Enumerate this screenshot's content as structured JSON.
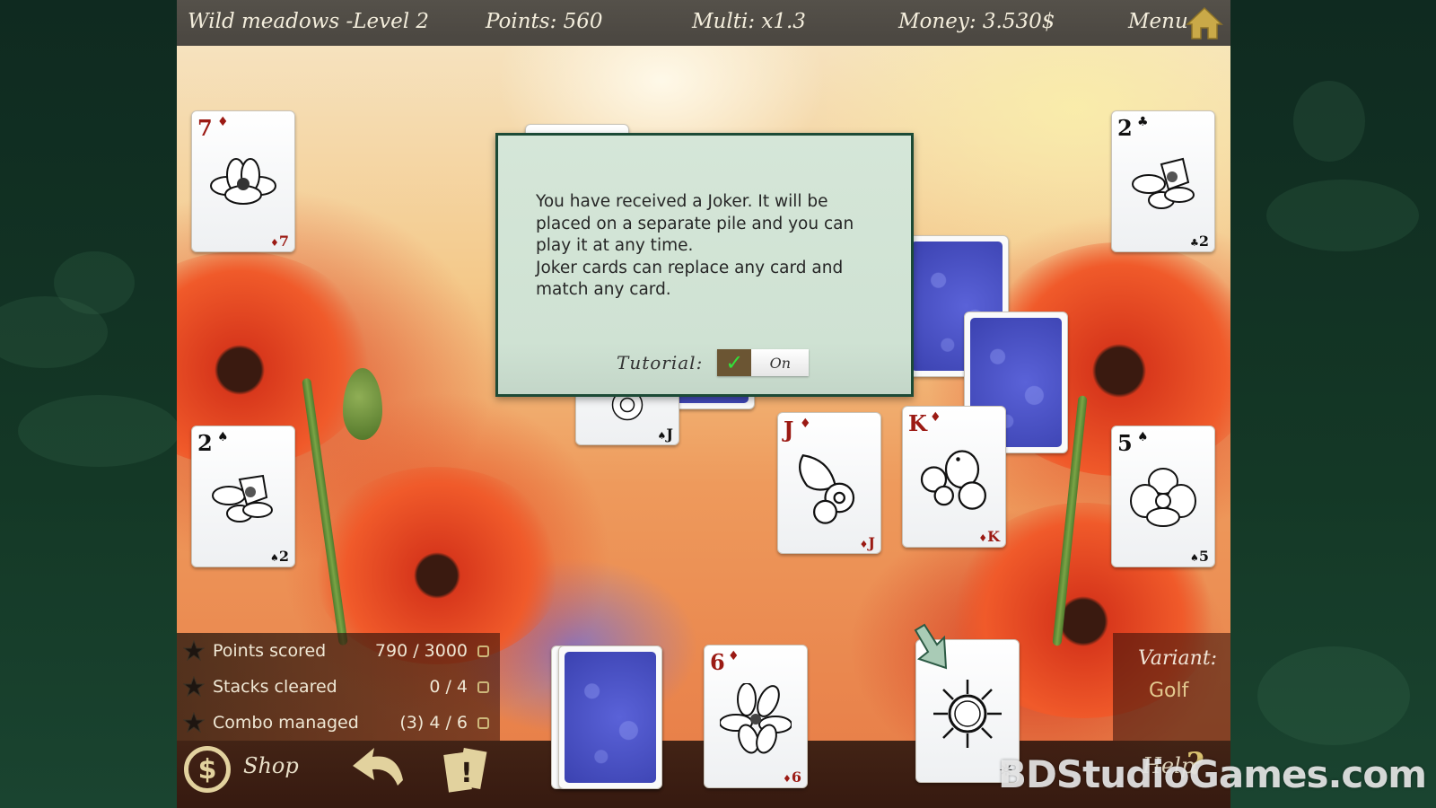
{
  "topbar": {
    "level_title": "Wild meadows -Level 2",
    "points": "Points: 560",
    "multiplier": "Multi: x1.3",
    "money": "Money: 3.530$",
    "menu_label": "Menu"
  },
  "dialog": {
    "message_lines": [
      "You have received a Joker. It will be placed on a separate pile and you can play it at any time.",
      "Joker cards can replace any card and match any card."
    ],
    "tutorial_label": "Tutorial:",
    "tutorial_state": "On",
    "tutorial_checked": true
  },
  "cards": {
    "top_left": {
      "rank": "7",
      "suit": "♦",
      "color": "red",
      "art": "magnolia"
    },
    "top_right": {
      "rank": "2",
      "suit": "♣",
      "color": "black",
      "art": "daffodil"
    },
    "mid_left": {
      "rank": "2",
      "suit": "♠",
      "color": "black",
      "art": "daffodil"
    },
    "mid_right": {
      "rank": "5",
      "suit": "♠",
      "color": "black",
      "art": "orchid"
    },
    "partial_under_dialog": {
      "rank": "J",
      "suit": "♠",
      "color": "black",
      "art": "daisy"
    },
    "center_j": {
      "rank": "J",
      "suit": "♦",
      "color": "red",
      "art": "butterfly"
    },
    "center_k": {
      "rank": "K",
      "suit": "♦",
      "color": "red",
      "art": "bird"
    },
    "waste": {
      "rank": "6",
      "suit": "♦",
      "color": "red",
      "art": "lily"
    },
    "joker": {
      "rank": "",
      "suit": "☼",
      "color": "black",
      "art": "sun"
    }
  },
  "goals": [
    {
      "label": "Points scored",
      "value": "790 / 3000",
      "done": false
    },
    {
      "label": "Stacks cleared",
      "value": "0 / 4",
      "done": false
    },
    {
      "label": "Combo managed",
      "value": "(3) 4 / 6",
      "done": false
    }
  ],
  "bottombar": {
    "shop_label": "Shop",
    "shop_icon": "$",
    "help_label": "Help",
    "help_icon": "?"
  },
  "variant": {
    "title": "Variant:",
    "value": "Golf"
  },
  "watermark": "BDStudioGames.com",
  "colors": {
    "card_red": "#9b1a14",
    "dialog_bg": "#d5e6d8",
    "dialog_border": "#1c4a36",
    "toggle_check": "#33e03a",
    "gold": "#e2d29e"
  }
}
